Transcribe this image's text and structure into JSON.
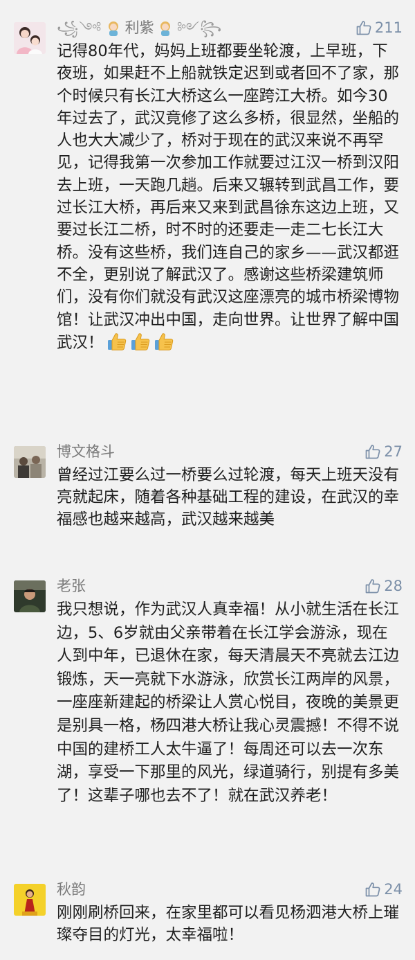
{
  "accent_color": "#7b8fa8",
  "comments": [
    {
      "name": "利紫",
      "name_decoration_left": "꧁༺",
      "name_decoration_right": "༻꧂",
      "likes": "211",
      "text": "记得80年代，妈妈上班都要坐轮渡，上早班，下夜班，如果赶不上船就铁定迟到或者回不了家，那个时候只有长江大桥这么一座跨江大桥。如今30年过去了，武汉竟修了这么多桥，很显然，坐船的人也大大减少了，桥对于现在的武汉来说不再罕见，记得我第一次参加工作就要过江汉一桥到汉阳去上班，一天跑几趟。后来又辗转到武昌工作，要过长江大桥，再后来又来到武昌徐东这边上班，又要过长江二桥，时不时的还要走一走二七长江大桥。没有这些桥，我们连自己的家乡——武汉都逛不全，更别说了解武汉了。感谢这些桥梁建筑师们，没有你们就没有武汉这座漂亮的城市桥梁博物馆！让武汉冲出中国，走向世界。让世界了解中国武汉！",
      "emoji": [
        "thumbs-up-emoji",
        "thumbs-up-emoji",
        "thumbs-up-emoji"
      ]
    },
    {
      "name": "博文格斗",
      "likes": "27",
      "text": "曾经过江要么过一桥要么过轮渡，每天上班天没有亮就起床，随着各种基础工程的建设，在武汉的幸福感也越来越高，武汉越来越美"
    },
    {
      "name": "老张",
      "likes": "28",
      "text": "我只想说，作为武汉人真幸福！从小就生活在长江边，5、6岁就由父亲带着在长江学会游泳，现在人到中年，已退休在家，每天清晨天不亮就去江边锻炼，天一亮就下水游泳，欣赏长江两岸的风景，一座座新建起的桥梁让人赏心悦目，夜晚的美景更是别具一格，杨四港大桥让我心灵震撼！不得不说中国的建桥工人太牛逼了！每周还可以去一次东湖，享受一下那里的风光，绿道骑行，别提有多美了！这辈子哪也去不了！就在武汉养老！"
    },
    {
      "name": "秋韵",
      "likes": "24",
      "text": "刚刚刷桥回来，在家里都可以看见杨泗港大桥上璀璨夺目的灯光，太幸福啦！"
    }
  ]
}
